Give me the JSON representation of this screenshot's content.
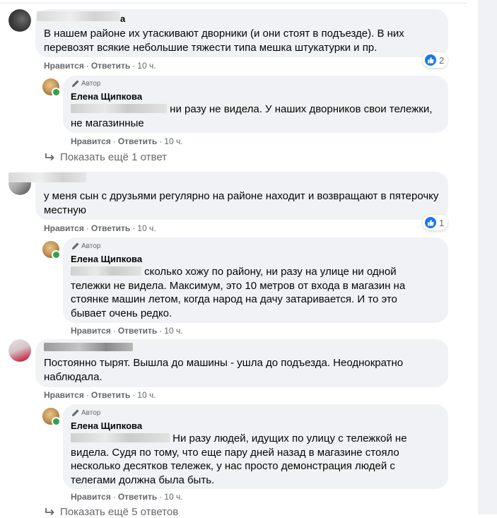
{
  "ui": {
    "like": "Нравится",
    "reply": "Ответить",
    "author_badge": "Автор",
    "sep": "·"
  },
  "threads": [
    {
      "comment": {
        "name_tail": "а",
        "text": "В нашем районе их утаскивают дворники (и они стоят в подъезде). В них перевозят всякие небольшие тяжести типа мешка штукатурки и пр.",
        "time": "10 ч.",
        "reactions": "2"
      },
      "reply": {
        "name": "Елена Щипкова",
        "text_after_mention": "ни разу не видела. У наших дворников свои тележки,",
        "text_line2": "не магазинные",
        "time": "10 ч."
      },
      "show_more": "Показать ещё 1 ответ"
    },
    {
      "comment": {
        "text": "у меня сын с друзьями регулярно на районе находит и возвращают в пятерочку местную",
        "time": "10 ч.",
        "reactions": "1"
      },
      "reply": {
        "name": "Елена Щипкова",
        "text_after_mention": "сколько хожу по району, ни разу на улице ни одной",
        "text_rest": "тележки не видела. Максимум, это 10 метров от входа в магазин на стоянке машин летом, когда народ на дачу затаривается. И то это бывает очень редко.",
        "time": "10 ч."
      }
    },
    {
      "comment": {
        "text": "Постоянно тырят. Вышла до машины - ушла до подъезда. Неоднократно наблюдала.",
        "time": "10 ч."
      },
      "reply": {
        "name": "Елена Щипкова",
        "text_after_mention": "Ни разу людей, идущих по улицу с тележкой не",
        "text_rest": "видела. Судя по тому, что еще пару дней назад в магазине стояло несколько десятков тележек, у нас просто демонстрация людей с телегами должна была быть.",
        "time": "10 ч."
      },
      "show_more": "Показать ещё 5 ответов"
    }
  ],
  "colors": {
    "bubble": "#f0f2f5",
    "meta": "#65676b",
    "like_blue": "#1877f2",
    "online": "#31a24c"
  },
  "icons": [
    "pencil-icon",
    "reply-arrow-icon",
    "like-icon"
  ]
}
